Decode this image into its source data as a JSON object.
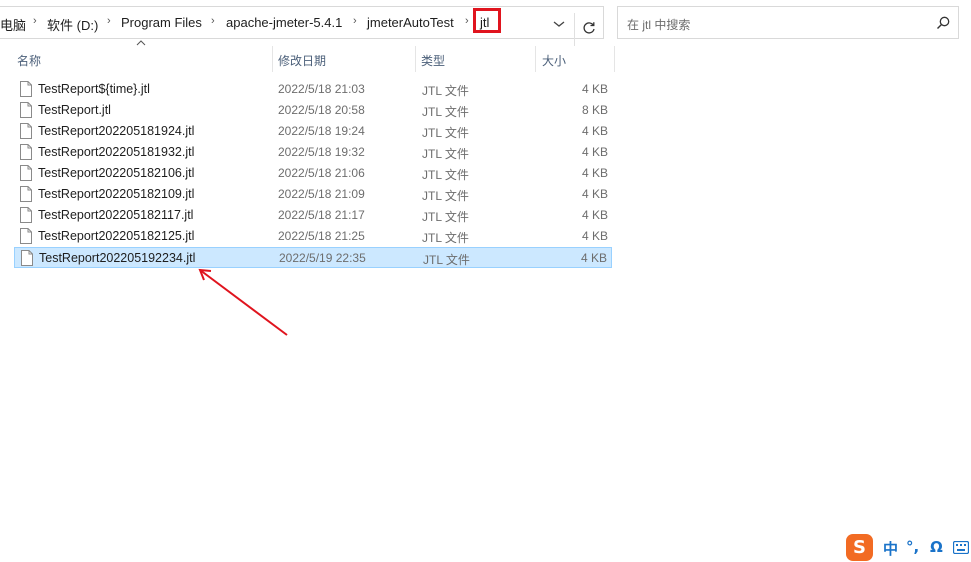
{
  "breadcrumb": {
    "items": [
      "电脑",
      "软件 (D:)",
      "Program Files",
      "apache-jmeter-5.4.1",
      "jmeterAutoTest",
      "jtl"
    ],
    "separator": "›"
  },
  "search": {
    "placeholder": "在 jtl 中搜索"
  },
  "columns": {
    "name": "名称",
    "date": "修改日期",
    "type": "类型",
    "size": "大小"
  },
  "files": [
    {
      "name": "TestReport${time}.jtl",
      "date": "2022/5/18 21:03",
      "type": "JTL 文件",
      "size": "4 KB"
    },
    {
      "name": "TestReport.jtl",
      "date": "2022/5/18 20:58",
      "type": "JTL 文件",
      "size": "8 KB"
    },
    {
      "name": "TestReport202205181924.jtl",
      "date": "2022/5/18 19:24",
      "type": "JTL 文件",
      "size": "4 KB"
    },
    {
      "name": "TestReport202205181932.jtl",
      "date": "2022/5/18 19:32",
      "type": "JTL 文件",
      "size": "4 KB"
    },
    {
      "name": "TestReport202205182106.jtl",
      "date": "2022/5/18 21:06",
      "type": "JTL 文件",
      "size": "4 KB"
    },
    {
      "name": "TestReport202205182109.jtl",
      "date": "2022/5/18 21:09",
      "type": "JTL 文件",
      "size": "4 KB"
    },
    {
      "name": "TestReport202205182117.jtl",
      "date": "2022/5/18 21:17",
      "type": "JTL 文件",
      "size": "4 KB"
    },
    {
      "name": "TestReport202205182125.jtl",
      "date": "2022/5/18 21:25",
      "type": "JTL 文件",
      "size": "4 KB"
    },
    {
      "name": "TestReport202205192234.jtl",
      "date": "2022/5/19 22:35",
      "type": "JTL 文件",
      "size": "4 KB",
      "selected": true
    }
  ],
  "ime": {
    "logo": "S",
    "mode": "中",
    "punct": "°,",
    "symbol": "Ω"
  },
  "icons": {
    "dropdown": "chevron-down-icon",
    "refresh": "refresh-icon",
    "search": "search-icon",
    "file": "file-icon",
    "keyboard": "keyboard-icon"
  },
  "colors": {
    "highlight_box": "#e0141e",
    "annotation_arrow": "#e0141e",
    "selected_row": "#cce8ff",
    "ime_brand": "#f26b23"
  }
}
